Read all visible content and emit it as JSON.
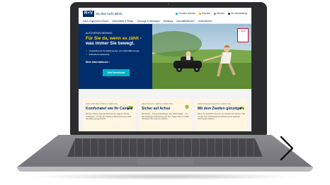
{
  "site": {
    "logo": "R+V",
    "slogan": "Du bist nicht allein.",
    "top_links": [
      {
        "label": "Kunden werden"
      },
      {
        "label": "Kontakt"
      },
      {
        "label": "Service"
      },
      {
        "label": "Zur Anmeldung"
      }
    ],
    "nav": [
      "Haus, Eigentum & Recht",
      "Gesundheit & Pflege",
      "Vorsorge & Vermögen",
      "Beratung",
      "Geschäftskunden",
      "Unternehmen"
    ]
  },
  "hero": {
    "kicker": "AUTOVERSICHERUNG",
    "title_accent": "Für Sie da, wenn es zählt",
    "title_rest": " - was immer Sie bewegt.",
    "bullets": [
      "Umweltbonus für Elektroautos und Hybridfahrzeuge",
      "Individuell anpassbar"
    ],
    "link": "Mehr Informationen",
    "link_arrow": "›",
    "button": "Jetzt berechnen",
    "badge": "TEST"
  },
  "cards": [
    {
      "kicker": "WOHNMOBILVERSICHERUNG",
      "title": "Komfortabel wie Ihr Camper",
      "text": "Mit dem Wohnmobil die Welt auf der eigenen Route entdecken - mit der R+V-Wohnmobilversicherung sind Sie dabei gut geschützt.",
      "icon": "camper-icon"
    },
    {
      "kicker": "ANHÄNGER VERSICHERUNG",
      "title": "Sicher auf Achse",
      "text": "Mit Pferde-, Transportanhänger oder Wohnwagen - mit der Anhängerversicherung der R+V haben Sie's im Griff. Vertrauen Sie unserem Schutz.",
      "icon": "shield-icon"
    },
    {
      "kicker": "ZWEITWAGENVERSICHERUNG",
      "title": "Mit dem Zweiten günstiger",
      "text": "Wenn Ihr Zweitfahrzeug nur am zweiten Ort stehen - Sie mit der R+V Zweitwagenversicherung bei weiteren Fahrzeugen sparen.",
      "icon": "car-icon"
    }
  ],
  "colors": {
    "brand": "#002e6d",
    "accent": "#ffd400",
    "button": "#00b2c7",
    "card_bg": "#fff5e1"
  },
  "icons": [
    "search-icon",
    "chevron-right-icon",
    "camper-icon",
    "shield-icon",
    "car-icon",
    "check-icon"
  ]
}
